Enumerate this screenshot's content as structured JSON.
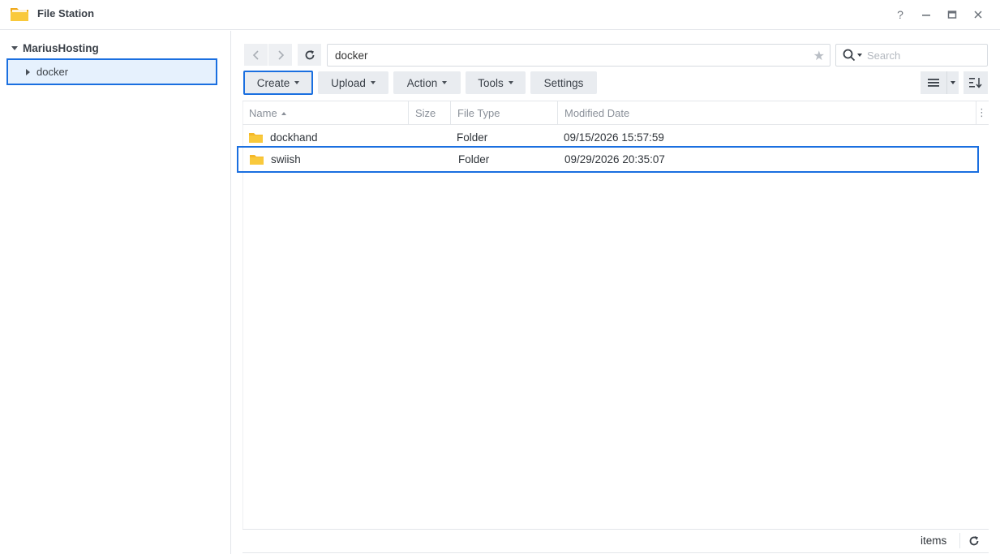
{
  "window": {
    "title": "File Station",
    "controls": {
      "help": "?",
      "minimize": "–",
      "maximize": "▭",
      "close": "✕"
    }
  },
  "sidebar": {
    "root_label": "MariusHosting",
    "items": [
      {
        "label": "docker",
        "selected": true
      }
    ]
  },
  "toolbar": {
    "path": "docker",
    "search_placeholder": "Search",
    "buttons": [
      {
        "label": "Create",
        "has_dropdown": true,
        "highlighted": true
      },
      {
        "label": "Upload",
        "has_dropdown": true
      },
      {
        "label": "Action",
        "has_dropdown": true
      },
      {
        "label": "Tools",
        "has_dropdown": true
      },
      {
        "label": "Settings",
        "has_dropdown": false
      }
    ]
  },
  "table": {
    "columns": [
      "Name",
      "Size",
      "File Type",
      "Modified Date"
    ],
    "sort": {
      "column": "Name",
      "direction": "ascending"
    },
    "rows": [
      {
        "name": "dockhand",
        "size": "",
        "type": "Folder",
        "modified": "09/15/2026 15:57:59",
        "selected": false
      },
      {
        "name": "swiish",
        "size": "",
        "type": "Folder",
        "modified": "09/29/2026 20:35:07",
        "selected": true
      }
    ]
  },
  "status": {
    "items_label": "items"
  },
  "colors": {
    "accent": "#1a6fe0",
    "selection_bg": "#e6f1fd",
    "folder": "#f5c33b"
  },
  "icons": [
    "folder-app-icon",
    "back-icon",
    "forward-icon",
    "refresh-icon",
    "star-icon",
    "search-icon",
    "list-view-icon",
    "sort-icon",
    "folder-icon"
  ]
}
